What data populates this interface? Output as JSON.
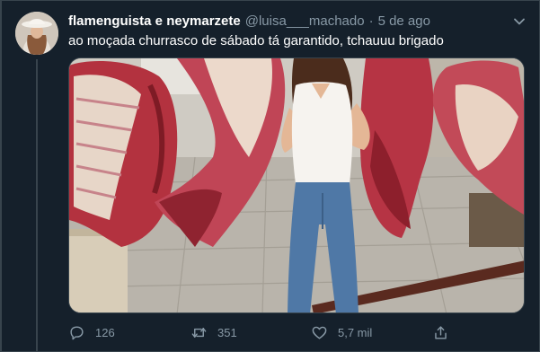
{
  "tweet": {
    "display_name": "flamenguista e neymarzete",
    "handle": "@luisa___machado",
    "separator": "·",
    "timestamp": "5 de ago",
    "text": "ao moçada churrasco de sábado tá garantido, tchauuu brigado"
  },
  "actions": {
    "reply_count": "126",
    "retweet_count": "351",
    "like_count": "5,7 mil"
  },
  "icons": {
    "caret": "chevron-down-icon",
    "reply": "reply-icon",
    "retweet": "retweet-icon",
    "like": "heart-icon",
    "share": "share-icon"
  },
  "colors": {
    "background": "#15202b",
    "secondary_text": "#8899a6",
    "border": "#38444d"
  }
}
